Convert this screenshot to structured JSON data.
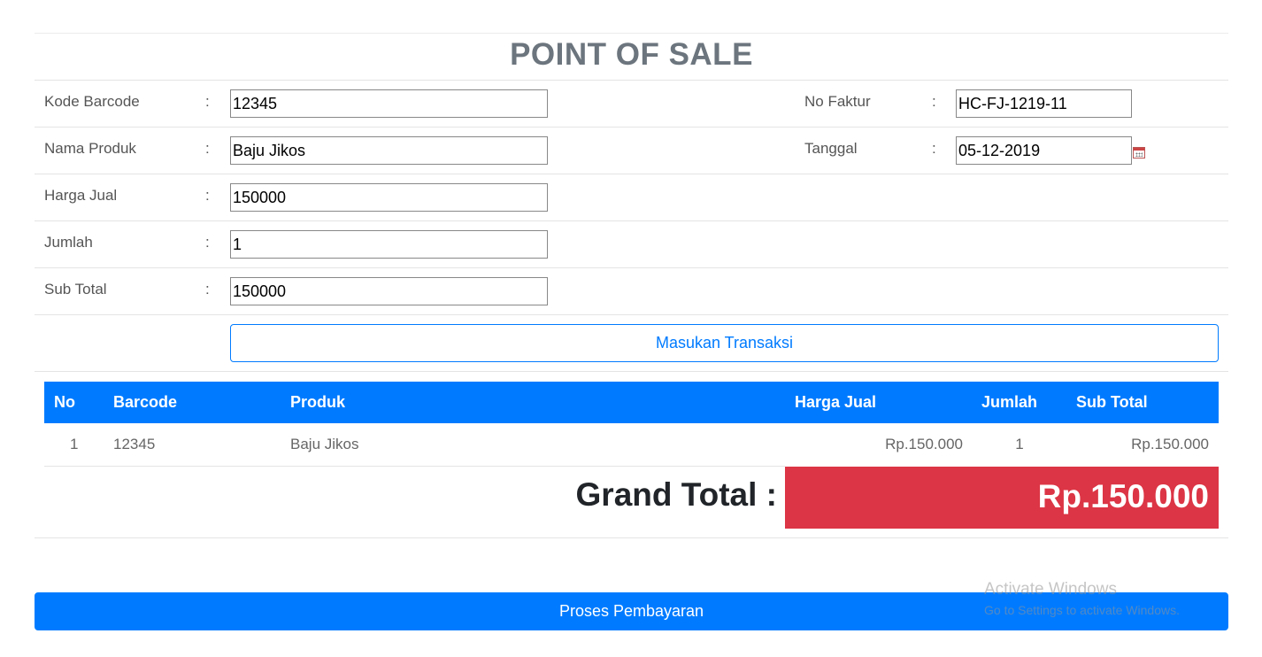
{
  "title": "POINT OF SALE",
  "form": {
    "kode_barcode": {
      "label": "Kode Barcode",
      "value": "12345"
    },
    "nama_produk": {
      "label": "Nama Produk",
      "value": "Baju Jikos"
    },
    "harga_jual": {
      "label": "Harga Jual",
      "value": "150000"
    },
    "jumlah": {
      "label": "Jumlah",
      "value": "1"
    },
    "sub_total": {
      "label": "Sub Total",
      "value": "150000"
    },
    "no_faktur": {
      "label": "No Faktur",
      "value": "HC-FJ-1219-11"
    },
    "tanggal": {
      "label": "Tanggal",
      "value": "05-12-2019"
    },
    "colon": ":"
  },
  "masukan_label": "Masukan Transaksi",
  "table": {
    "headers": [
      "No",
      "Barcode",
      "Produk",
      "Harga Jual",
      "Jumlah",
      "Sub Total"
    ],
    "rows": [
      [
        "1",
        "12345",
        "Baju Jikos",
        "Rp.150.000",
        "1",
        "Rp.150.000"
      ]
    ]
  },
  "grand_total": {
    "label": "Grand Total :",
    "value": "Rp.150.000"
  },
  "proses_label": "Proses Pembayaran",
  "watermark": {
    "line1": "Activate Windows",
    "line2": "Go to Settings to activate Windows."
  },
  "colors": {
    "primary": "#007bff",
    "danger": "#dc3545",
    "title": "#6c757d"
  }
}
